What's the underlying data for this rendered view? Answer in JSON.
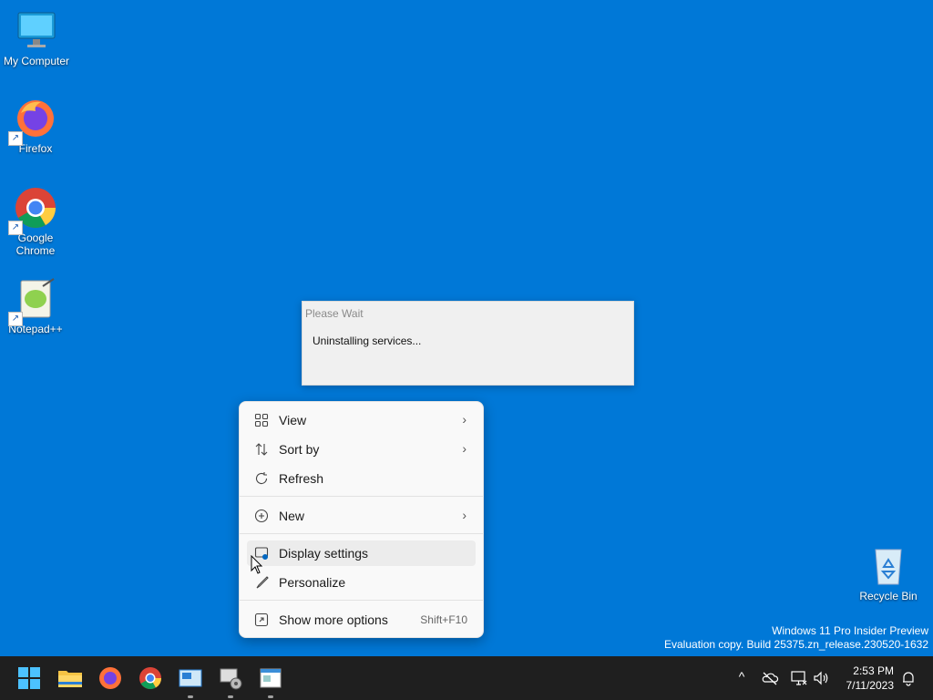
{
  "desktop": {
    "icons": [
      {
        "label": "My Computer"
      },
      {
        "label": "Firefox"
      },
      {
        "label": "Google Chrome"
      },
      {
        "label": "Notepad++"
      },
      {
        "label": "Recycle Bin"
      }
    ]
  },
  "dialog": {
    "title": "Please Wait",
    "message": "Uninstalling services..."
  },
  "context_menu": {
    "items": [
      {
        "label": "View",
        "icon": "grid-icon",
        "submenu": true
      },
      {
        "label": "Sort by",
        "icon": "sort-icon",
        "submenu": true
      },
      {
        "label": "Refresh",
        "icon": "refresh-icon"
      },
      {
        "label": "New",
        "icon": "plus-circle-icon",
        "submenu": true
      },
      {
        "label": "Display settings",
        "icon": "display-settings-icon",
        "highlighted": true
      },
      {
        "label": "Personalize",
        "icon": "brush-icon"
      },
      {
        "label": "Show more options",
        "icon": "more-options-icon",
        "shortcut": "Shift+F10"
      }
    ],
    "submenu_arrow": "›"
  },
  "watermark": {
    "line1": "Windows 11 Pro Insider Preview",
    "line2": "Evaluation copy. Build 25375.zn_release.230520-1632"
  },
  "taskbar": {
    "apps": [
      "start-button",
      "file-explorer",
      "firefox",
      "chrome",
      "control-panel",
      "setup",
      "window"
    ],
    "clock_time": "2:53 PM",
    "clock_date": "7/11/2023",
    "tray_chevron": "^"
  },
  "colors": {
    "desktop_bg": "#0078d7",
    "taskbar_bg": "#1f1f1f",
    "menu_bg": "#f9f9f9"
  }
}
